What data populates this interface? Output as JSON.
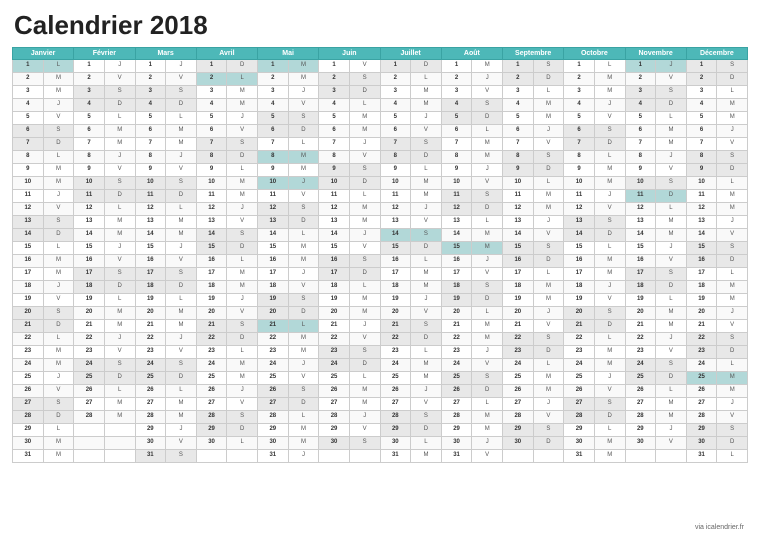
{
  "title": "Calendrier 2018",
  "footer": "via icalendrier.fr",
  "months": [
    {
      "label": "Janvier",
      "col": 1
    },
    {
      "label": "Février",
      "col": 2
    },
    {
      "label": "Mars",
      "col": 3
    },
    {
      "label": "Avril",
      "col": 4
    },
    {
      "label": "Mai",
      "col": 5
    },
    {
      "label": "Juin",
      "col": 6
    },
    {
      "label": "Juillet",
      "col": 7
    },
    {
      "label": "Août",
      "col": 8
    },
    {
      "label": "Septembre",
      "col": 9
    },
    {
      "label": "Octobre",
      "col": 10
    },
    {
      "label": "Novembre",
      "col": 11
    },
    {
      "label": "Décembre",
      "col": 12
    }
  ],
  "rows": 31
}
